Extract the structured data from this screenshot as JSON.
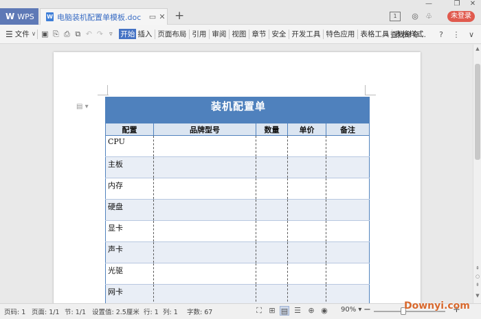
{
  "titlebar": {
    "app_tab_label": "WPS",
    "app_logo": "W",
    "doc_tab_title": "电脑装机配置单模板.doc",
    "doc_icon_letter": "W",
    "login_label": "未登录",
    "icons": [
      "wps-logo-icon",
      "doc-file-icon",
      "monitor-icon",
      "close-icon",
      "plus-icon",
      "minimize-icon",
      "restore-icon",
      "window-close-icon",
      "panel-icon",
      "skin-icon",
      "gift-icon"
    ]
  },
  "ribbon": {
    "menu_label": "文件",
    "tabs": [
      {
        "label": "开始",
        "active": true
      },
      {
        "label": "插入"
      },
      {
        "label": "页面布局"
      },
      {
        "label": "引用"
      },
      {
        "label": "审阅"
      },
      {
        "label": "视图"
      },
      {
        "label": "章节"
      },
      {
        "label": "安全"
      },
      {
        "label": "开发工具"
      },
      {
        "label": "特色应用"
      },
      {
        "label": "表格工具"
      },
      {
        "label": "表格样式"
      }
    ],
    "find_label": "查找命令...",
    "accent_color": "#4472c4"
  },
  "document": {
    "table_title": "装机配置单",
    "columns": [
      "配置",
      "品牌型号",
      "数量",
      "单价",
      "备注"
    ],
    "rows": [
      "CPU",
      "主板",
      "内存",
      "硬盘",
      "显卡",
      "声卡",
      "光驱",
      "网卡"
    ],
    "header_color": "#4f81bd",
    "alt_row_color": "#e9eef6"
  },
  "status": {
    "page_no": "页码: 1",
    "pages": "页面: 1/1",
    "section": "节: 1/1",
    "setting": "设置值: 2.5厘米",
    "row": "行: 1",
    "col": "列: 1",
    "word_count": "字数: 67",
    "zoom": "90%",
    "zoom_value": 0.9
  },
  "watermark": "Downyi.com"
}
